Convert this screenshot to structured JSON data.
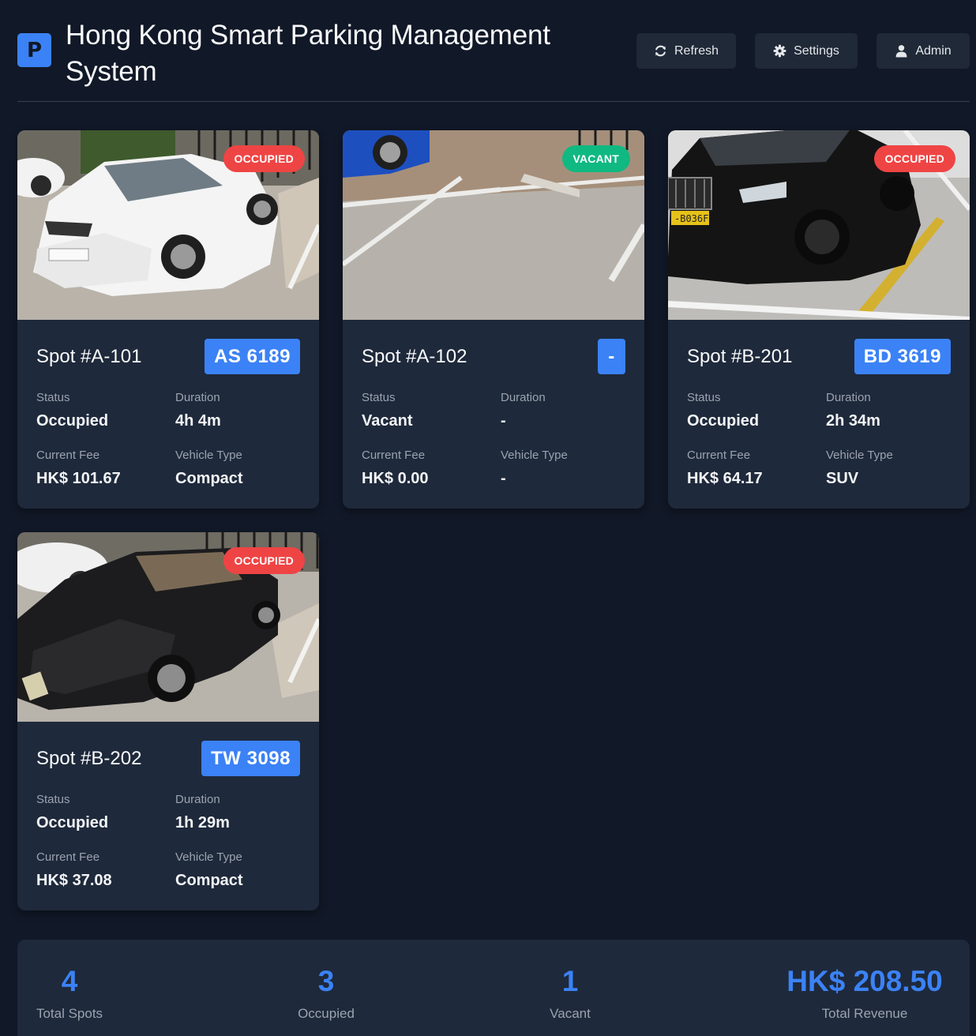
{
  "header": {
    "title": "Hong Kong Smart Parking Management System",
    "logo_letter": "P",
    "buttons": {
      "refresh": "Refresh",
      "settings": "Settings",
      "admin": "Admin"
    }
  },
  "labels": {
    "status": "Status",
    "duration": "Duration",
    "current_fee": "Current Fee",
    "vehicle_type": "Vehicle Type"
  },
  "spots": [
    {
      "badge": "OCCUPIED",
      "title": "Spot #A-101",
      "plate": "AS 6189",
      "status": "Occupied",
      "duration": "4h 4m",
      "fee": "HK$ 101.67",
      "vehicle_type": "Compact"
    },
    {
      "badge": "VACANT",
      "title": "Spot #A-102",
      "plate": "-",
      "status": "Vacant",
      "duration": "-",
      "fee": "HK$ 0.00",
      "vehicle_type": "-"
    },
    {
      "badge": "OCCUPIED",
      "title": "Spot #B-201",
      "plate": "BD 3619",
      "status": "Occupied",
      "duration": "2h 34m",
      "fee": "HK$ 64.17",
      "vehicle_type": "SUV"
    },
    {
      "badge": "OCCUPIED",
      "title": "Spot #B-202",
      "plate": "TW 3098",
      "status": "Occupied",
      "duration": "1h 29m",
      "fee": "HK$ 37.08",
      "vehicle_type": "Compact"
    }
  ],
  "summary": {
    "total_spots": {
      "value": "4",
      "label": "Total Spots"
    },
    "occupied": {
      "value": "3",
      "label": "Occupied"
    },
    "vacant": {
      "value": "1",
      "label": "Vacant"
    },
    "total_revenue": {
      "value": "HK$ 208.50",
      "label": "Total Revenue"
    }
  },
  "colors": {
    "background": "#111827",
    "card": "#1e293b",
    "accent": "#3b82f6",
    "occupied": "#ef4444",
    "vacant": "#10b981"
  }
}
